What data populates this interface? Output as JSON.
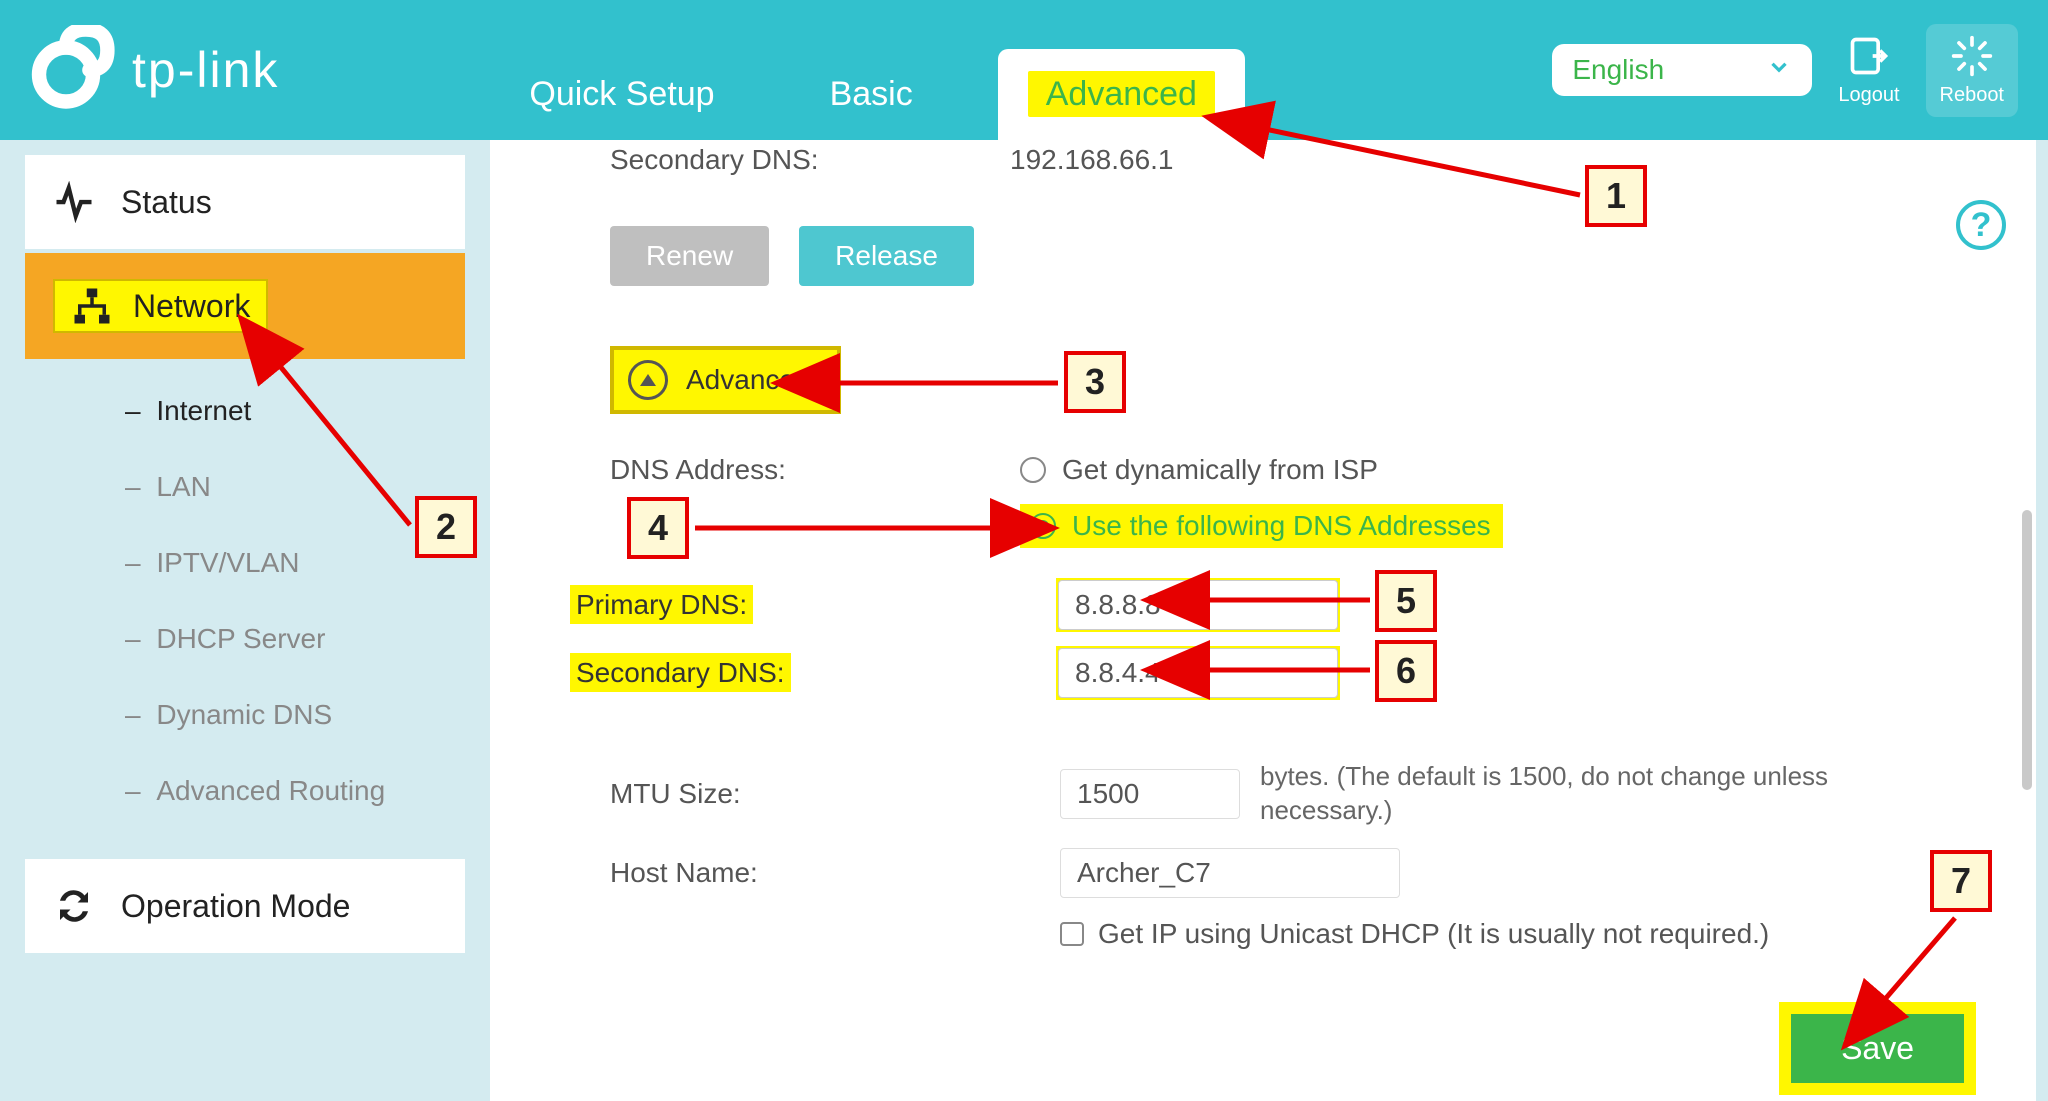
{
  "header": {
    "brand": "tp-link",
    "tabs": {
      "quick": "Quick Setup",
      "basic": "Basic",
      "advanced": "Advanced"
    },
    "lang": "English",
    "logout": "Logout",
    "reboot": "Reboot"
  },
  "sidebar": {
    "status": "Status",
    "network": "Network",
    "operation": "Operation Mode",
    "sub": {
      "internet": "Internet",
      "lan": "LAN",
      "iptv": "IPTV/VLAN",
      "dhcp": "DHCP Server",
      "ddns": "Dynamic DNS",
      "routing": "Advanced Routing"
    }
  },
  "main": {
    "sec_dns_lbl": "Secondary DNS:",
    "sec_dns_val": "192.168.66.1",
    "renew": "Renew",
    "release": "Release",
    "advanced_section": "Advanced",
    "dns_addr_lbl": "DNS Address:",
    "radio_isp": "Get dynamically from ISP",
    "radio_manual": "Use the following DNS Addresses",
    "primary_dns_lbl": "Primary DNS:",
    "primary_dns_val": "8.8.8.8",
    "secondary_dns_lbl": "Secondary DNS:",
    "secondary_dns_val": "8.8.4.4",
    "mtu_lbl": "MTU Size:",
    "mtu_val": "1500",
    "mtu_hint": "bytes. (The default is 1500, do not change unless necessary.)",
    "host_lbl": "Host Name:",
    "host_val": "Archer_C7",
    "unicast": "Get IP using Unicast DHCP (It is usually not required.)",
    "save": "Save"
  },
  "callouts": {
    "1": "1",
    "2": "2",
    "3": "3",
    "4": "4",
    "5": "5",
    "6": "6",
    "7": "7"
  }
}
